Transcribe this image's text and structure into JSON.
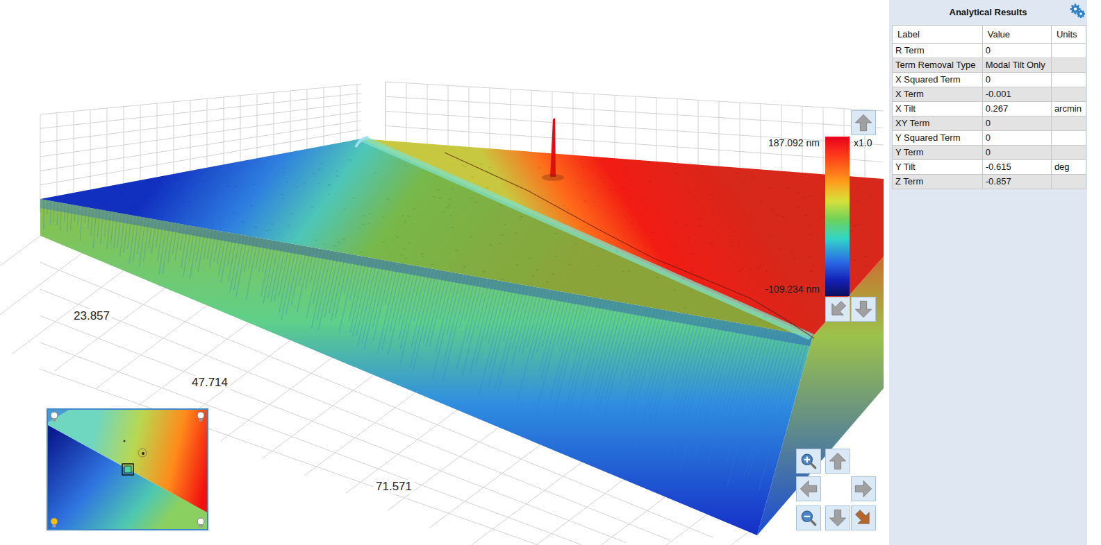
{
  "view": {
    "axis_ticks": [
      "23.857",
      "47.714",
      "71.571"
    ],
    "scale": {
      "max": "187.092 nm",
      "min": "-109.234 nm",
      "zoom": "x1.0"
    }
  },
  "minimap": {
    "lights": [
      {
        "on": false
      },
      {
        "on": false
      },
      {
        "on": true
      },
      {
        "on": false
      }
    ]
  },
  "panel": {
    "title": "Analytical Results",
    "columns": [
      "Label",
      "Value",
      "Units"
    ],
    "rows": [
      [
        "R Term",
        "0",
        ""
      ],
      [
        "Term Removal Type",
        "Modal Tilt Only",
        ""
      ],
      [
        "X Squared Term",
        "0",
        ""
      ],
      [
        "X Term",
        "-0.001",
        ""
      ],
      [
        "X Tilt",
        "0.267",
        "arcmin"
      ],
      [
        "XY Term",
        "0",
        ""
      ],
      [
        "Y Squared Term",
        "0",
        ""
      ],
      [
        "Y Term",
        "0",
        ""
      ],
      [
        "Y Tilt",
        "-0.615",
        "deg"
      ],
      [
        "Z Term",
        "-0.857",
        ""
      ]
    ]
  }
}
